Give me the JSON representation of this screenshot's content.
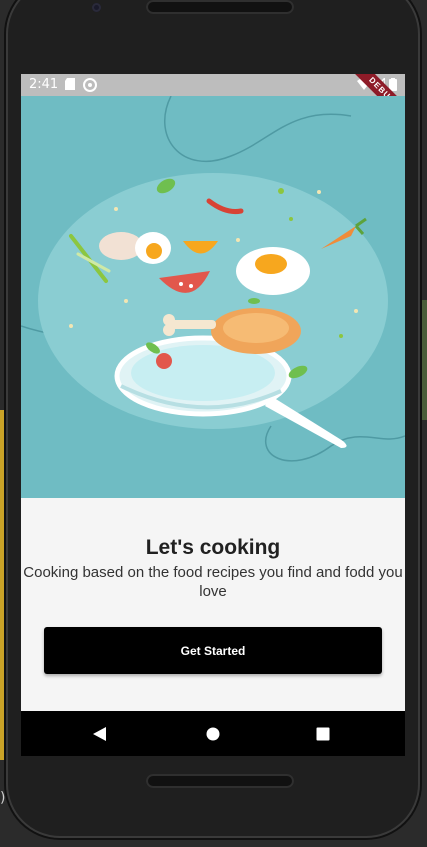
{
  "status_bar": {
    "time": "2:41",
    "ribbon": "DEBUG"
  },
  "onboarding": {
    "title": "Let's cooking",
    "subtitle": "Cooking based on the food recipes you find and fodd you love",
    "button_label": "Get Started"
  },
  "nav": {
    "back": "back-icon",
    "home": "home-icon",
    "recents": "recents-icon"
  },
  "colors": {
    "hero_bg": "#6fbcc3",
    "button": "#000000",
    "ribbon": "#8e1b28"
  },
  "background": {
    "fragment_text": ")."
  }
}
